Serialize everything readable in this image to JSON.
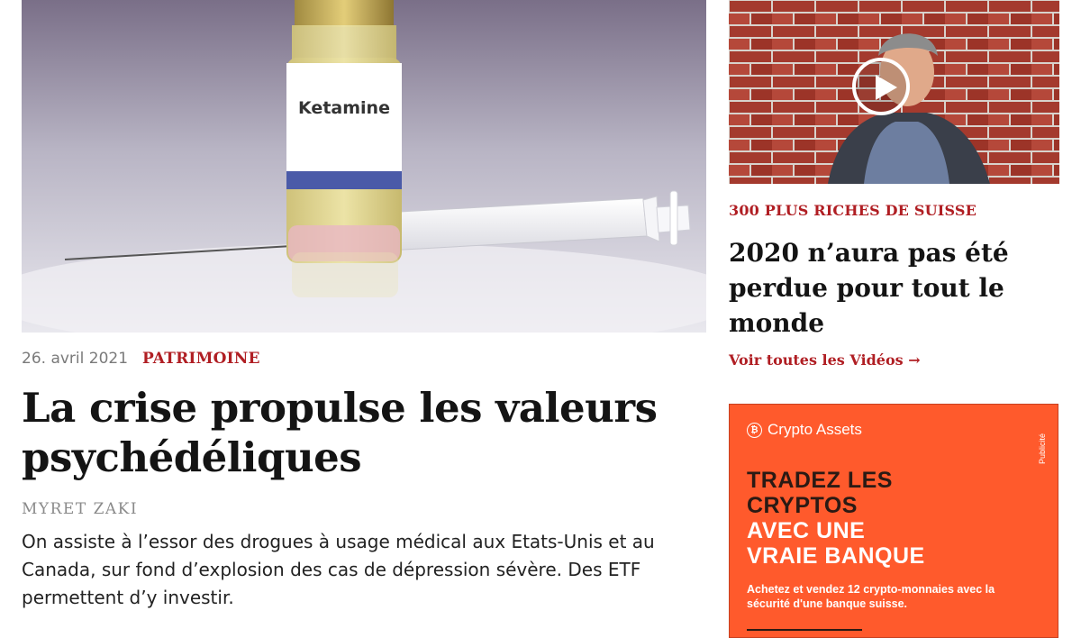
{
  "main_article": {
    "image_label": "Ketamine",
    "date": "26. avril 2021",
    "category": "PATRIMOINE",
    "title": "La crise propulse les valeurs psychédéliques",
    "author": "MYRET ZAKI",
    "lead": "On assiste à l’essor des drogues à usage médical aux Etats-Unis et au Canada, sur fond d’explosion des cas de dépression sévère. Des ETF permettent d’y investir."
  },
  "video_teaser": {
    "category": "300 PLUS RICHES DE SUISSE",
    "title": "2020 n’aura pas été perdue pour tout le monde",
    "all_videos_link": "Voir toutes les Vidéos →"
  },
  "advertisement": {
    "brand": "Crypto Assets",
    "brand_icon_glyph": "₿",
    "tag": "Publicité",
    "headline_lines": [
      "TRADEZ LES",
      "CRYPTOS",
      "AVEC UNE",
      "VRAIE BANQUE"
    ],
    "body": "Achetez et vendez 12 crypto-monnaies avec la sécurité d'une banque suisse.",
    "background_color": "#ff5a2c"
  },
  "colors": {
    "accent": "#b01e23",
    "headline": "#141414",
    "muted": "#7a7a7a"
  }
}
